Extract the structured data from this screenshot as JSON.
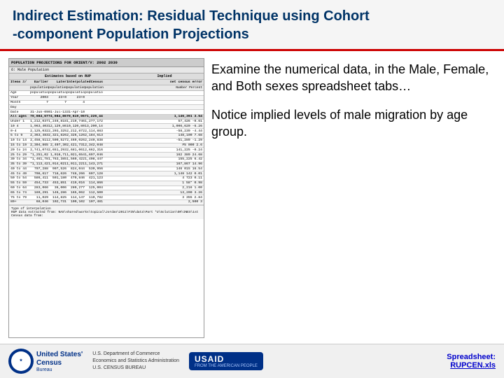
{
  "header": {
    "line1": "Indirect Estimation:  Residual Technique using   Cohort",
    "line2": "-component Population Projections"
  },
  "spreadsheet": {
    "title": "POPULATION PROJECTIONS FOR ORIENT/V: 2002 2030",
    "subtitle": "6: Male Population",
    "col_headers_1": [
      "",
      "Estimates based on RUP",
      "",
      "",
      "Implied"
    ],
    "col_headers_2": [
      "Items #/",
      "Earlier",
      "Later",
      "Interpolated",
      "Census",
      "net census error"
    ],
    "col_headers_3": [
      "",
      "",
      "",
      "population",
      "population",
      "Number  Percent"
    ],
    "rows": [
      {
        "label": "Age",
        "v1": "population",
        "v2": "population",
        "v3": "population",
        "v4": "population",
        "v5": "",
        "class": ""
      },
      {
        "label": "Year",
        "v1": "2003",
        "v2": "23+0",
        "v3": "23+0",
        "v4": "",
        "v5": "",
        "class": ""
      },
      {
        "label": "Month",
        "v1": "7",
        "v2": "7",
        "v3": "4",
        "v4": "",
        "v5": "",
        "class": ""
      },
      {
        "label": "Day",
        "v1": "",
        "v2": "",
        "v3": "",
        "v4": "",
        "v5": "",
        "class": ""
      },
      {
        "label": "Date",
        "v1": "31-Jun-09",
        "v2": "01-Jul-13",
        "v3": "31-Apr-10",
        "v4": "",
        "v5": "",
        "class": ""
      },
      {
        "label": "All ages",
        "v1": "70,084,671",
        "v2": "74,084,869",
        "v3": "70,619,060",
        "v4": "71,226,441",
        "v5": "1,146,391  3.54",
        "class": "bold-row"
      },
      {
        "label": "Under 1",
        "v1": "1,212,037",
        "v2": "1,246,818",
        "v3": "1,219,746",
        "v4": "1,277,172",
        "v5": "57,426  -0.61",
        "class": ""
      },
      {
        "label": "10 4",
        "v1": "1,963,403",
        "v2": "12,129,868",
        "v3": "10,120,806",
        "v4": "13,200,146",
        "v5": "1,006,620  -6.26",
        "class": ""
      },
      {
        "label": "0-4",
        "v1": "2,125,032",
        "v2": "2,203,325",
        "v3": "2,212,872",
        "v4": "2,114,883",
        "v5": "-58,239  -4.44",
        "class": ""
      },
      {
        "label": "5 to 9",
        "v1": "2,363,483",
        "v2": "2,321,826",
        "v3": "2,326,126",
        "v4": "2,184,613",
        "v5": "148,100  7.68",
        "class": ""
      },
      {
        "label": "10 to 14",
        "v1": "2,458,511",
        "v2": "2,500,527",
        "v3": "2,469,026",
        "v4": "2,240,838",
        "v5": "-51,289  -1.29",
        "class": ""
      },
      {
        "label": "15 to 19",
        "v1": "2,304,865",
        "v2": "2,407,30",
        "v3": "2,421,731",
        "v4": "2,342,048",
        "v5": "#5 000  2.6",
        "class": ""
      },
      {
        "label": "20 to 24",
        "v1": "2,741,074",
        "v2": "2,651,293",
        "v3": "2,681,061",
        "v4": "2,662,316",
        "v5": "141,225  -0.24",
        "class": ""
      },
      {
        "label": "25 to 29",
        "v1": "*1,251,02",
        "v2": "1,018,71",
        "v3": "1,021,654",
        "v4": "1,697,046",
        "v5": "162 389  24.68",
        "class": ""
      },
      {
        "label": "30 to 34",
        "v1": "*1,461,786",
        "v2": "1,763,385",
        "v3": "1,560,422",
        "v4": "1,408,447",
        "v5": "155,225  6.42",
        "class": ""
      },
      {
        "label": "35 to 39",
        "v1": "*1,113,421",
        "v2": "1,014,021",
        "v3": "1,011,221",
        "v4": "1,143,271",
        "v5": "167,867  14.96",
        "class": ""
      },
      {
        "label": "40 to 44",
        "v1": "707,288",
        "v2": "907,526",
        "v3": "824,044",
        "v4": "530,956",
        "v5": "146 015  16.54",
        "class": ""
      },
      {
        "label": "45 to 49",
        "v1": "708,617",
        "v2": "718,626",
        "v3": "748,266",
        "v4": "607,128",
        "v5": "1,148 142  0.01",
        "class": ""
      },
      {
        "label": "50 to 54",
        "v1": "586,411",
        "v2": "501,180",
        "v3": "470,846",
        "v4": "421,123",
        "v5": "4 723  0.11",
        "class": ""
      },
      {
        "label": "55 to 59",
        "v1": "454,733",
        "v2": "453,851",
        "v3": "419,016",
        "v4": "114,866",
        "v5": "1 58*  0.98",
        "class": ""
      },
      {
        "label": "60 to 64",
        "v1": "283,066",
        "v2": "36,006",
        "v3": "280,277",
        "v4": "125,004",
        "v5": "2,216  1.00",
        "class": ""
      },
      {
        "label": "65 to 74",
        "v1": "169,291",
        "v2": "146,286",
        "v3": "165,062",
        "v4": "112,500",
        "v5": "13,200  3.26",
        "class": ""
      },
      {
        "label": "75 to 79",
        "v1": "11,029",
        "v2": "114,825",
        "v3": "114,147",
        "v4": "110,782",
        "v5": "3 355  2.84",
        "class": ""
      },
      {
        "label": "80+",
        "v1": "68,046",
        "v2": "102,731",
        "v3": "100,102",
        "v4": "107,481",
        "v5": "2,500  3",
        "class": ""
      }
    ],
    "footer_lines": [
      "Type of interpolation",
      "RUP data extracted from:   NAS\\shared\\works\\topical\\Jordan\\2011\\FIN\\data\\Part *U\\Solution\\OR\\INEX\\1st",
      "Census data from:"
    ]
  },
  "text_blocks": {
    "block1": "Examine the numerical data, in the Male, Female, and Both sexes spreadsheet tabs…",
    "block2": "Notice implied levels of male migration by age group."
  },
  "footer": {
    "census_line1": "United States'",
    "census_line2": "Census",
    "census_line3": "Bureau",
    "commerce_line1": "U.S. Department of Commerce",
    "commerce_line2": "Economics and Statistics Administration",
    "commerce_line3": "U.S. CENSUS BUREAU",
    "usaid_main": "USAID",
    "usaid_sub": "FROM THE AMERICAN PEOPLE",
    "spreadsheet_label": "Spreadsheet:",
    "spreadsheet_file": "RUPCEN.xls"
  }
}
